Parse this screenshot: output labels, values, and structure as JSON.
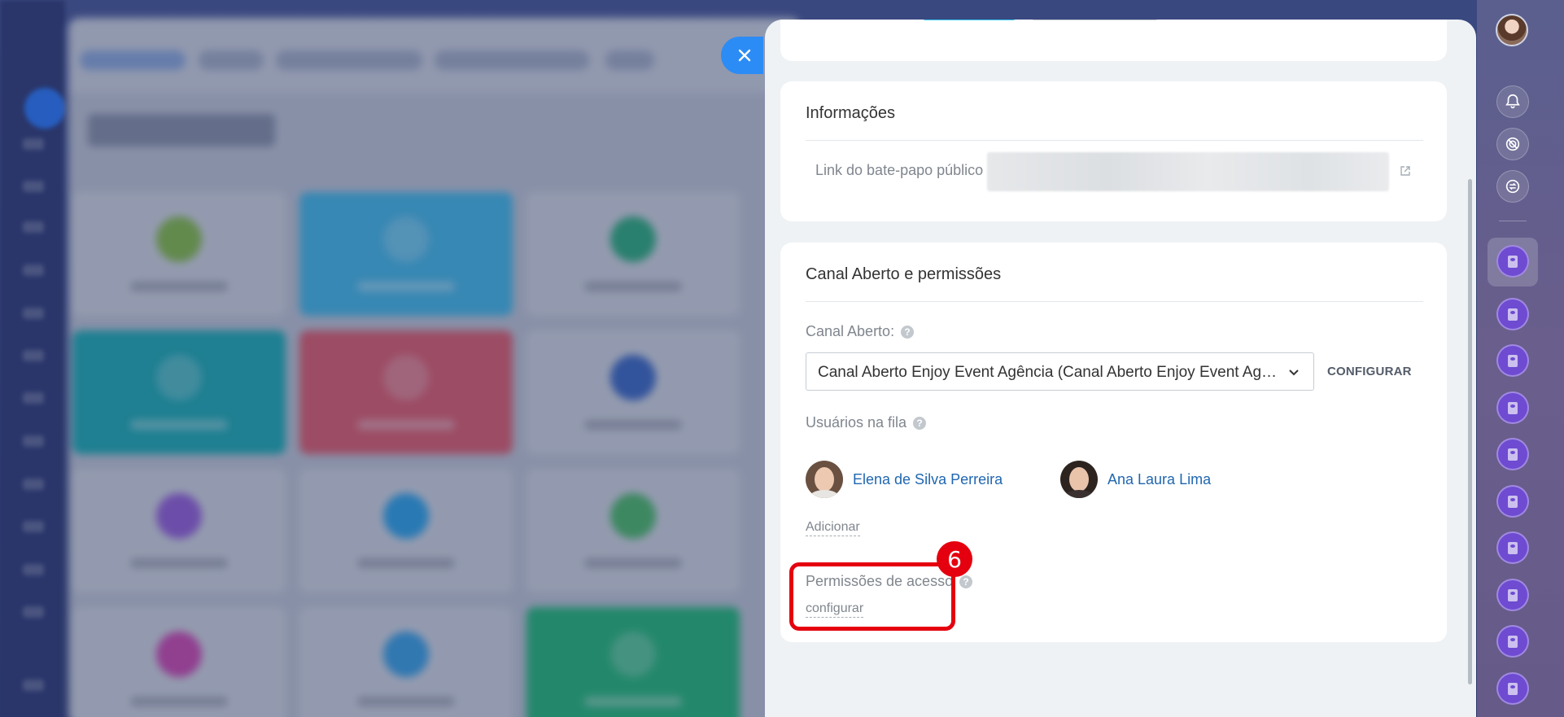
{
  "close_button": {
    "icon": "close-icon"
  },
  "info_card": {
    "title": "Informações",
    "public_chat_link_label": "Link do bate-papo público"
  },
  "permissions_card": {
    "title": "Canal Aberto e permissões",
    "open_channel_label": "Canal Aberto:",
    "open_channel_value": "Canal Aberto Enjoy Event Agência (Canal Aberto Enjoy Event Agên...",
    "configure_button": "CONFIGURAR",
    "queue_users_label": "Usuários na fila",
    "queue_users": [
      {
        "name": "Elena de Silva Perreira"
      },
      {
        "name": "Ana Laura Lima"
      }
    ],
    "add_link": "Adicionar",
    "access_permissions_label": "Permissões de acesso",
    "access_permissions_link": "configurar"
  },
  "annotation": {
    "step_number": "6",
    "color": "#e5000f"
  },
  "colors": {
    "accent_blue": "#2c8cf5",
    "link_blue": "#2067b0",
    "panel_bg": "#eef2f4",
    "rail_app": "#6e4bd1"
  }
}
